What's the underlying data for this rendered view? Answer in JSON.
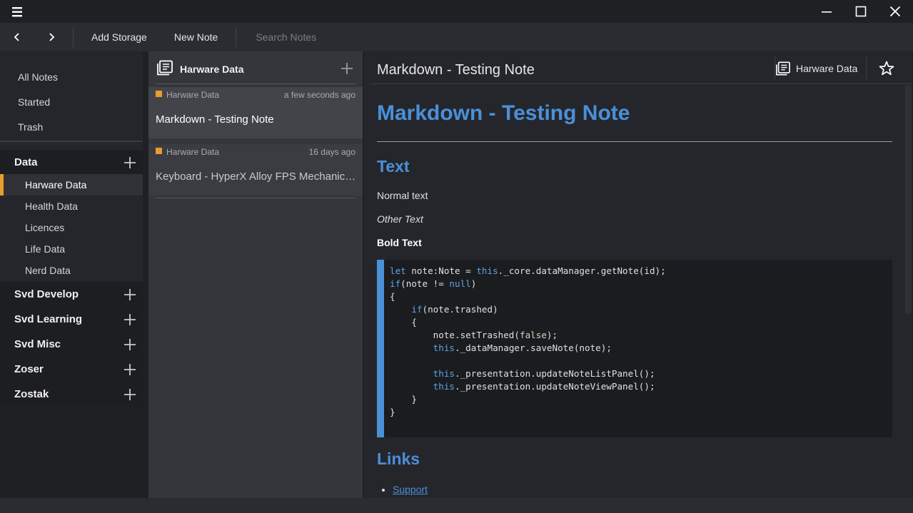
{
  "titlebar": {
    "menu_icon": "hamburger-icon",
    "minimize_icon": "minimize-icon",
    "maximize_icon": "maximize-icon",
    "close_icon": "close-icon"
  },
  "toolbar": {
    "back_icon": "chevron-left-icon",
    "forward_icon": "chevron-right-icon",
    "add_storage_label": "Add Storage",
    "new_note_label": "New Note",
    "search_placeholder": "Search Notes"
  },
  "sidebar": {
    "top_items": [
      "All Notes",
      "Started",
      "Trash"
    ],
    "groups": [
      {
        "label": "Data",
        "children": [
          "Harware Data",
          "Health Data",
          "Licences",
          "Life Data",
          "Nerd Data"
        ],
        "active_child": "Harware Data"
      },
      {
        "label": "Svd Develop"
      },
      {
        "label": "Svd Learning"
      },
      {
        "label": "Svd Misc"
      },
      {
        "label": "Zoser"
      },
      {
        "label": "Zostak"
      }
    ]
  },
  "notelist": {
    "title": "Harware Data",
    "notes": [
      {
        "folder": "Harware Data",
        "time": "a few seconds ago",
        "title": "Markdown - Testing Note",
        "selected": true
      },
      {
        "folder": "Harware Data",
        "time": "16 days ago",
        "title": "Keyboard - HyperX Alloy FPS Mechanical Gaming Keyboard",
        "selected": false
      }
    ]
  },
  "noteview": {
    "title": "Markdown - Testing Note",
    "folder": "Harware Data",
    "star_icon": "star-icon",
    "content": {
      "h1": "Markdown - Testing Note",
      "h2_text": "Text",
      "normal": "Normal text",
      "italic": "Other Text",
      "bold": "Bold Text",
      "code_lines": [
        "let note:Note = this._core.dataManager.getNote(id);",
        "if(note != null)",
        "{",
        "    if(note.trashed)",
        "    {",
        "        note.setTrashed(false);",
        "        this._dataManager.saveNote(note);",
        "",
        "        this._presentation.updateNoteListPanel();",
        "        this._presentation.updateNoteViewPanel();",
        "    }",
        "}"
      ],
      "h2_links": "Links",
      "links": [
        "Support"
      ]
    }
  },
  "colors": {
    "accent": "#4a90d9",
    "folder_tag": "#e89c2e",
    "background": "#1f2024"
  }
}
